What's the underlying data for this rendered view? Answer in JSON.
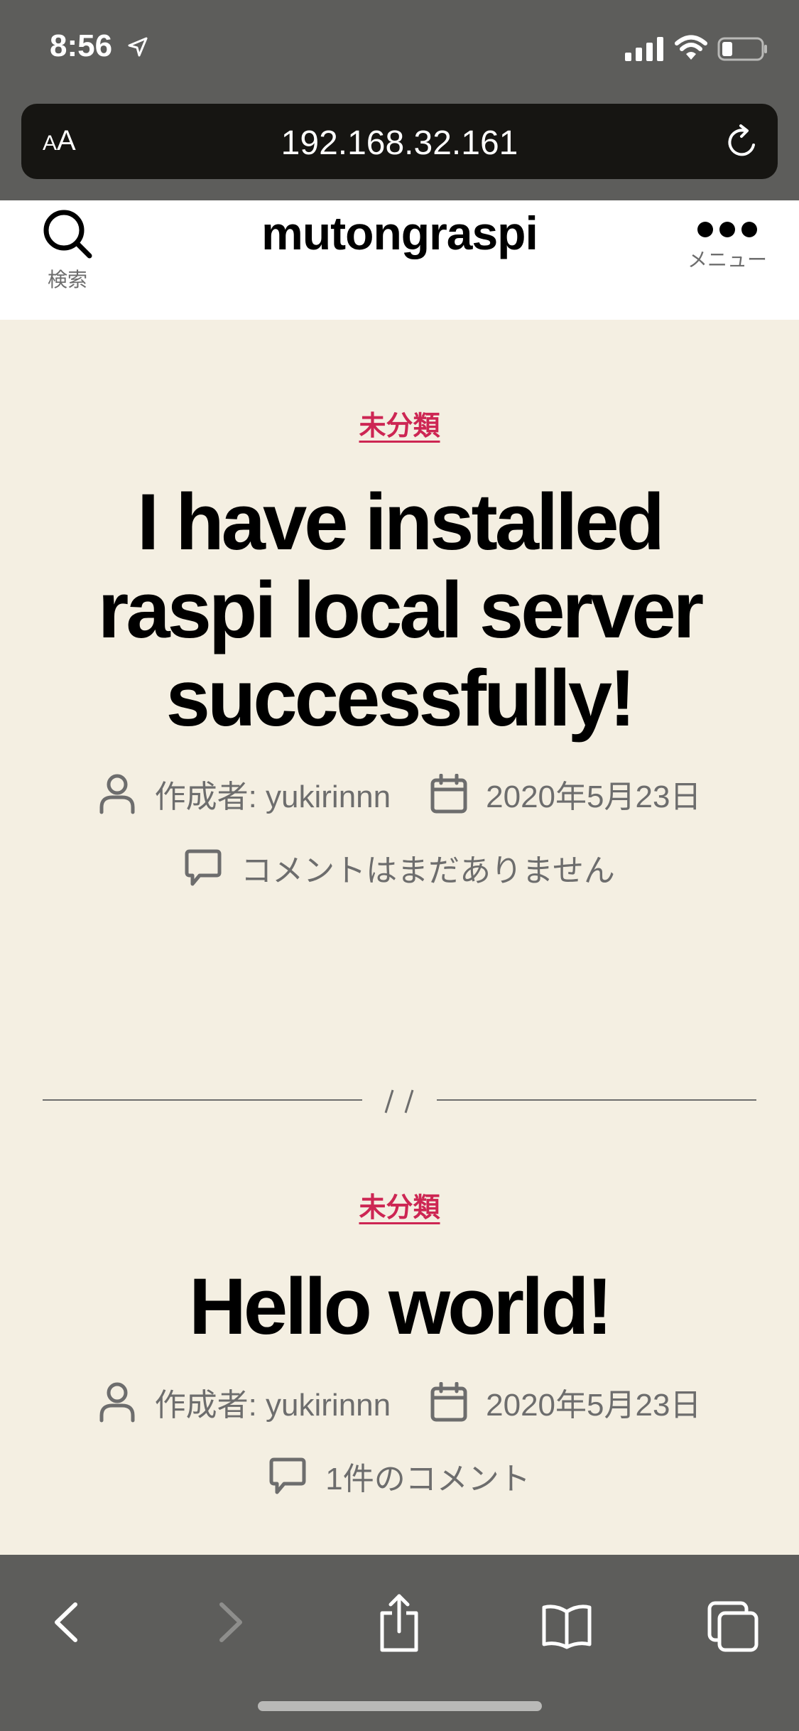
{
  "status_bar": {
    "time": "8:56"
  },
  "browser": {
    "text_size_label_small": "A",
    "text_size_label_large": "A",
    "url": "192.168.32.161"
  },
  "site": {
    "title": "mutongraspi",
    "search_label": "検索",
    "menu_label": "メニュー"
  },
  "posts": [
    {
      "category": "未分類",
      "title": "I have installed raspi local server successfully!",
      "author": "作成者: yukirinnn",
      "date": "2020年5月23日",
      "comments": "コメントはまだありません"
    },
    {
      "category": "未分類",
      "title": "Hello world!",
      "author": "作成者: yukirinnn",
      "date": "2020年5月23日",
      "comments": "1件のコメント"
    }
  ],
  "separator_text": "//",
  "colors": {
    "accent": "#cd2653",
    "background": "#f4efe2",
    "chrome": "#5d5d5b",
    "meta_text": "#6d6d6d"
  }
}
